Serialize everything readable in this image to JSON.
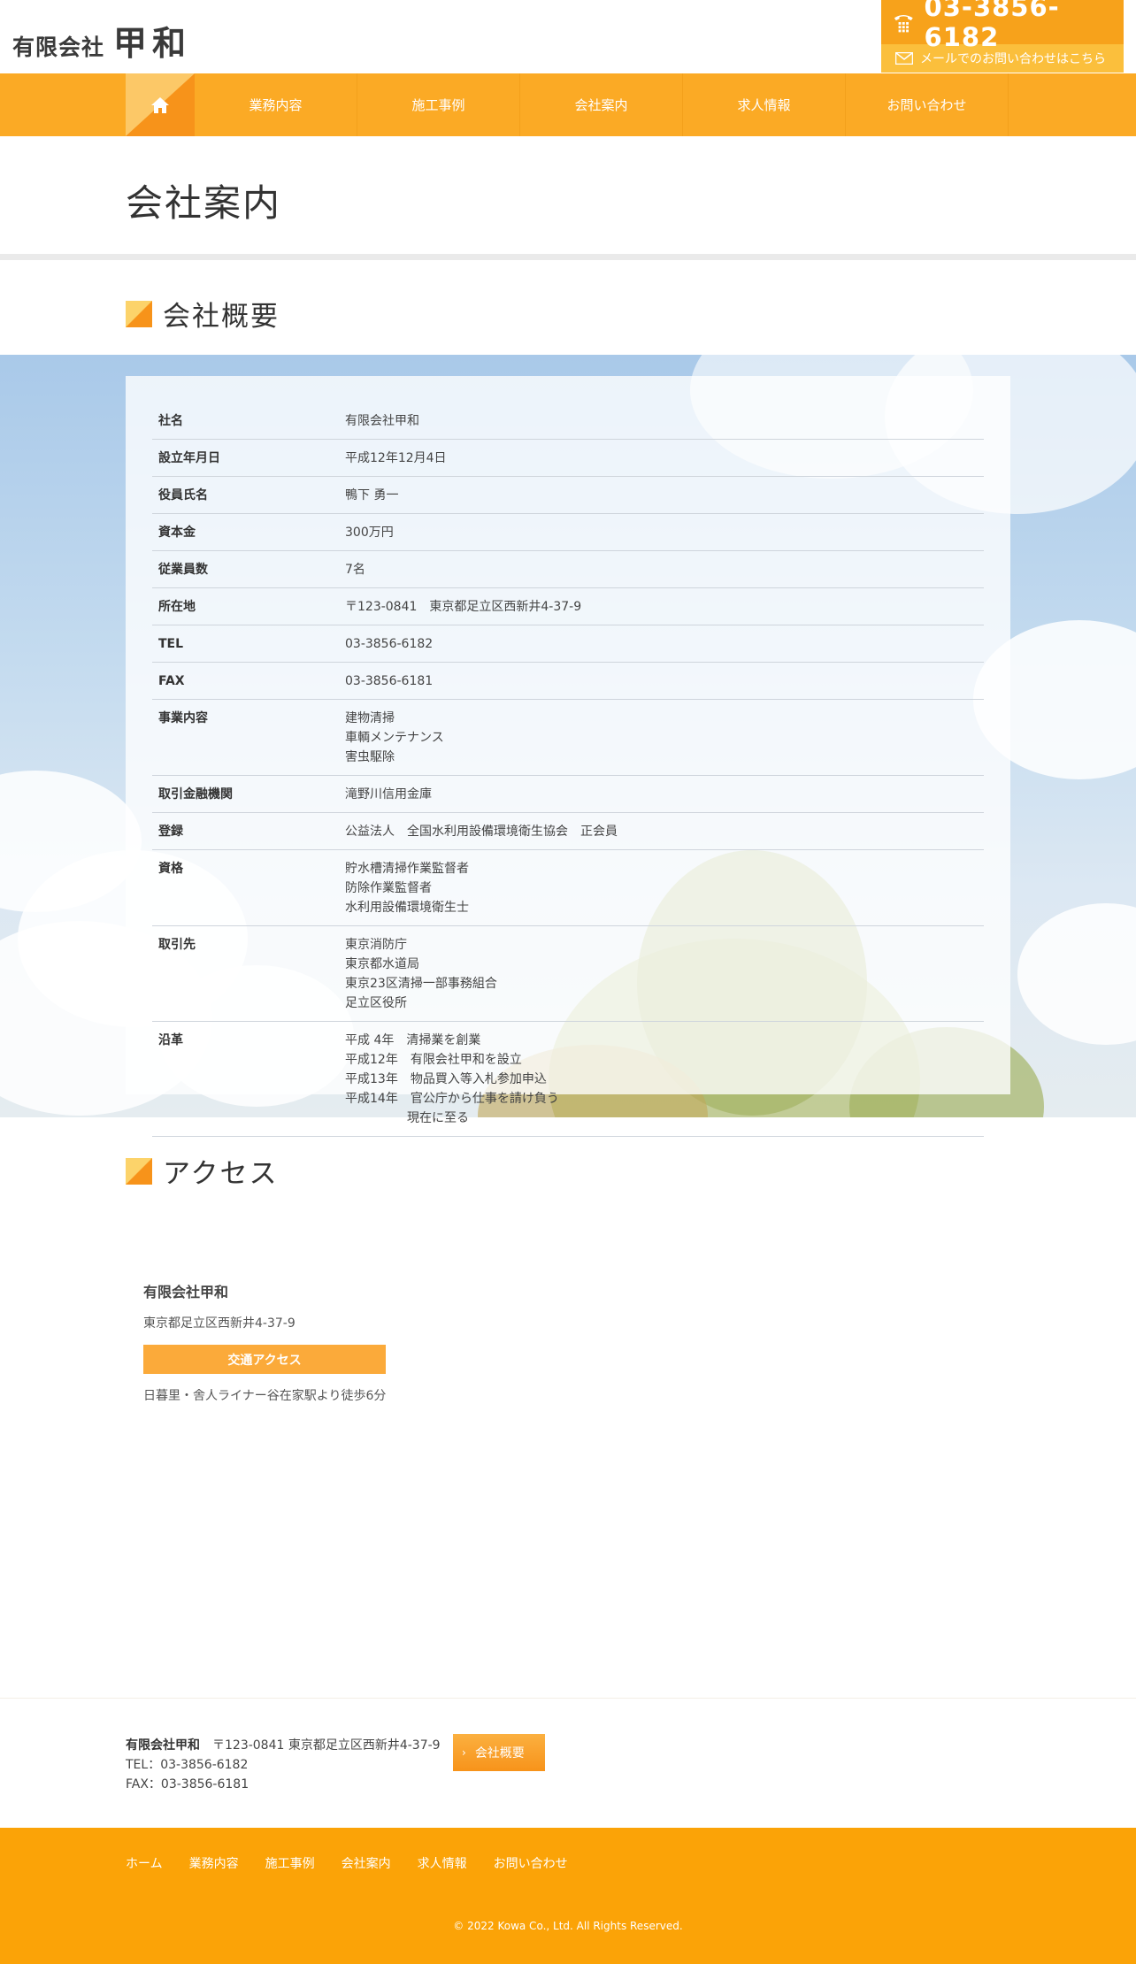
{
  "header": {
    "logo_small": "有限会社",
    "logo_big": "甲和",
    "tel": "03-3856-6182",
    "mail_link": "メールでのお問い合わせはこちら",
    "colors": {
      "accent": "#fbaa25",
      "accent_dark": "#f7931a"
    }
  },
  "nav": {
    "home_icon": "home-icon",
    "items": [
      {
        "label": "業務内容"
      },
      {
        "label": "施工事例"
      },
      {
        "label": "会社案内"
      },
      {
        "label": "求人情報"
      },
      {
        "label": "お問い合わせ"
      }
    ]
  },
  "page": {
    "title": "会社案内"
  },
  "overview": {
    "heading": "会社概要",
    "rows": [
      {
        "key": "社名",
        "lines": [
          "有限会社甲和"
        ]
      },
      {
        "key": "設立年月日",
        "lines": [
          "平成12年12月4日"
        ]
      },
      {
        "key": "役員氏名",
        "lines": [
          "鴨下 勇一"
        ]
      },
      {
        "key": "資本金",
        "lines": [
          "300万円"
        ]
      },
      {
        "key": "従業員数",
        "lines": [
          "7名"
        ]
      },
      {
        "key": "所在地",
        "lines": [
          "〒123-0841　東京都足立区西新井4-37-9"
        ]
      },
      {
        "key": "TEL",
        "lines": [
          "03-3856-6182"
        ]
      },
      {
        "key": "FAX",
        "lines": [
          "03-3856-6181"
        ]
      },
      {
        "key": "事業内容",
        "lines": [
          "建物清掃",
          "車輌メンテナンス",
          "害虫駆除"
        ]
      },
      {
        "key": "取引金融機関",
        "lines": [
          "滝野川信用金庫"
        ]
      },
      {
        "key": "登録",
        "lines": [
          "公益法人　全国水利用設備環境衛生協会　正会員"
        ]
      },
      {
        "key": "資格",
        "lines": [
          "貯水槽清掃作業監督者",
          "防除作業監督者",
          "水利用設備環境衛生士"
        ]
      },
      {
        "key": "取引先",
        "lines": [
          "東京消防庁",
          "東京都水道局",
          "東京23区清掃一部事務組合",
          "足立区役所"
        ]
      },
      {
        "key": "沿革",
        "lines": [
          "平成 4年　清掃業を創業",
          "平成12年　有限会社甲和を設立",
          "平成13年　物品買入等入札参加申込",
          "平成14年　官公庁から仕事を請け負う",
          "　　　　　現在に至る"
        ]
      }
    ]
  },
  "access": {
    "heading": "アクセス",
    "name": "有限会社甲和",
    "address": "東京都足立区西新井4-37-9",
    "button": "交通アクセス",
    "note": "日暮里・舎人ライナー谷在家駅より徒歩6分"
  },
  "footer_info": {
    "name": "有限会社甲和",
    "address": "〒123-0841 東京都足立区西新井4-37-9",
    "tel": "TEL：03-3856-6182",
    "fax": "FAX：03-3856-6181",
    "button": "会社概要"
  },
  "footer": {
    "nav": [
      "ホーム",
      "業務内容",
      "施工事例",
      "会社案内",
      "求人情報",
      "お問い合わせ"
    ],
    "copyright": "© 2022 Kowa Co., Ltd. All Rights Reserved."
  }
}
